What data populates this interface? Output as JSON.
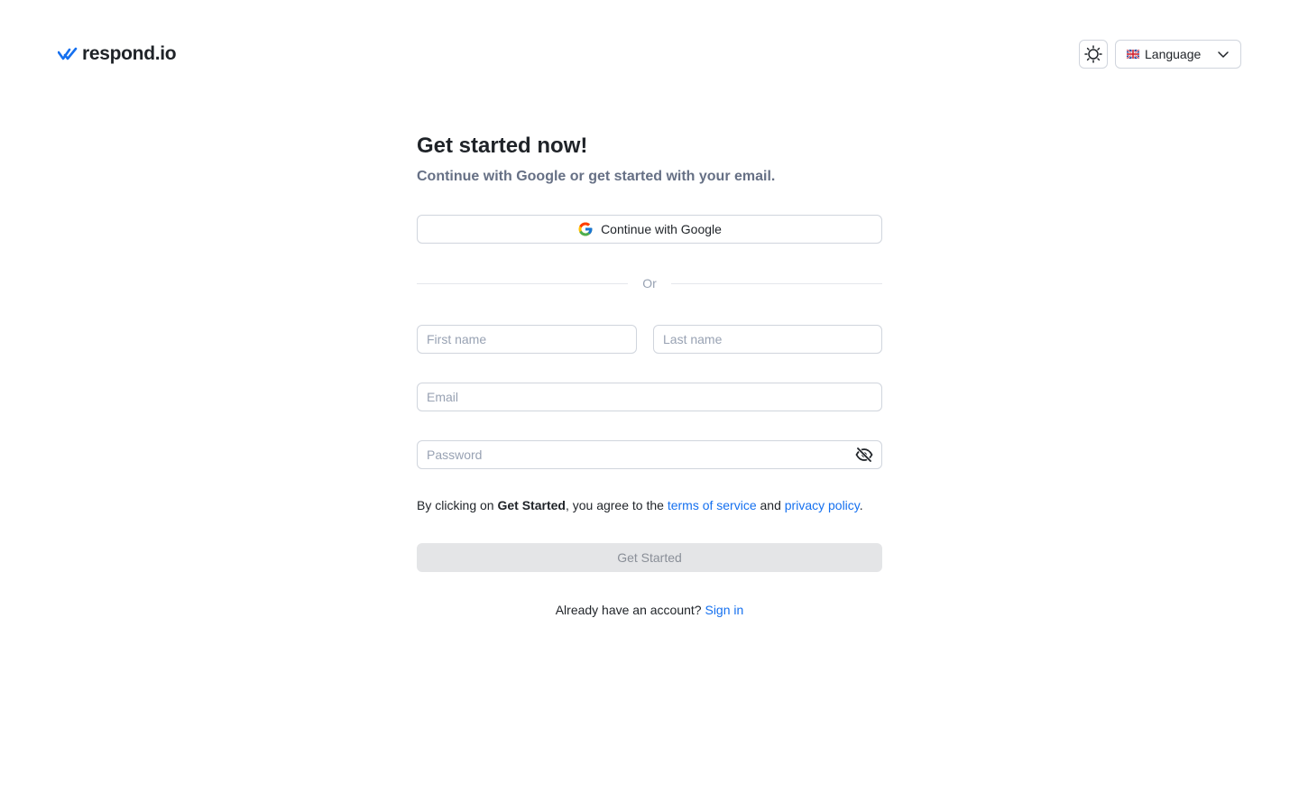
{
  "header": {
    "logo_text": "respond.io",
    "language": {
      "label": "Language",
      "flag_icon": "uk-flag-icon"
    },
    "theme_icon": "sun-icon"
  },
  "form": {
    "title": "Get started now!",
    "subtitle": "Continue with Google or get started with your email.",
    "google_button": "Continue with Google",
    "divider": "Or",
    "first_name": {
      "placeholder": "First name",
      "value": ""
    },
    "last_name": {
      "placeholder": "Last name",
      "value": ""
    },
    "email": {
      "placeholder": "Email",
      "value": ""
    },
    "password": {
      "placeholder": "Password",
      "value": "",
      "toggle_icon": "eye-off-icon"
    },
    "terms": {
      "prefix": "By clicking on ",
      "bold": "Get Started",
      "middle": ", you agree to the ",
      "tos_link": "terms of service",
      "and": " and ",
      "privacy_link": "privacy policy",
      "suffix": "."
    },
    "submit": "Get Started",
    "signin_prompt": "Already have an account? ",
    "signin_link": "Sign in"
  },
  "colors": {
    "accent": "#1570ef",
    "disabled_bg": "#e4e5e7",
    "muted_text": "#667085"
  }
}
